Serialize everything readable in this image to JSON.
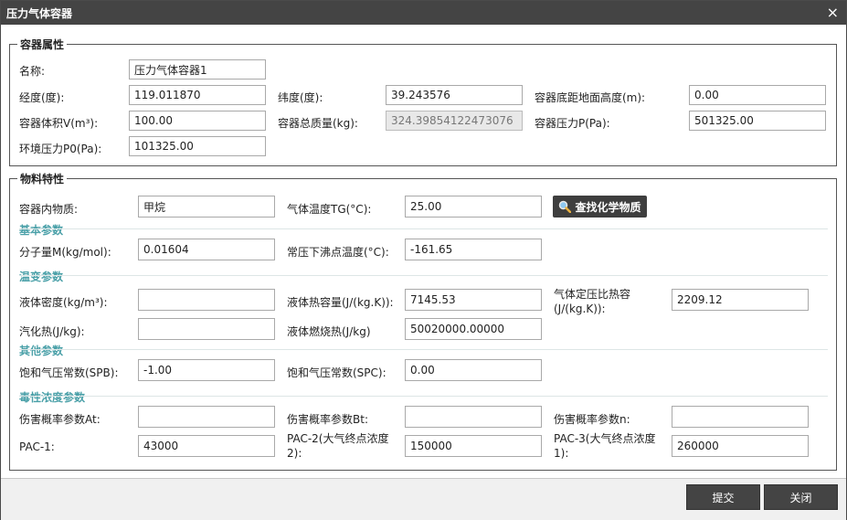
{
  "dialog": {
    "title": "压力气体容器",
    "close_icon": "×"
  },
  "container_props": {
    "legend": "容器属性",
    "name_label": "名称:",
    "name_value": "压力气体容器1",
    "lon_label": "经度(度):",
    "lon_value": "119.011870",
    "lat_label": "纬度(度):",
    "lat_value": "39.243576",
    "height_label": "容器底距地面高度(m):",
    "height_value": "0.00",
    "volume_label": "容器体积V(m³):",
    "volume_value": "100.00",
    "mass_label": "容器总质量(kg):",
    "mass_value": "324.39854122473076",
    "pressure_label": "容器压力P(Pa):",
    "pressure_value": "501325.00",
    "env_pressure_label": "环境压力P0(Pa):",
    "env_pressure_value": "101325.00"
  },
  "material_props": {
    "legend": "物料特性",
    "substance_label": "容器内物质:",
    "substance_value": "甲烷",
    "gas_temp_label": "气体温度TG(°C):",
    "gas_temp_value": "25.00",
    "search_button": "查找化学物质",
    "basic_heading": "基本参数",
    "mw_label": "分子量M(kg/mol):",
    "mw_value": "0.01604",
    "bp_label": "常压下沸点温度(°C):",
    "bp_value": "-161.65",
    "temp_heading": "温变参数",
    "liq_density_label": "液体密度(kg/m³):",
    "liq_density_value": "",
    "liq_heat_cap_label": "液体热容量(J/(kg.K)):",
    "liq_heat_cap_value": "7145.53",
    "gas_cp_label": "气体定压比热容(J/(kg.K)):",
    "gas_cp_value": "2209.12",
    "vap_heat_label": "汽化热(J/kg):",
    "vap_heat_value": "",
    "comb_heat_label": "液体燃烧热(J/kg)",
    "comb_heat_value": "50020000.00000",
    "other_heading": "其他参数",
    "spb_label": "饱和气压常数(SPB):",
    "spb_value": "-1.00",
    "spc_label": "饱和气压常数(SPC):",
    "spc_value": "0.00",
    "tox_heading": "毒性浓度参数",
    "at_label": "伤害概率参数At:",
    "at_value": "",
    "bt_label": "伤害概率参数Bt:",
    "bt_value": "",
    "n_label": "伤害概率参数n:",
    "n_value": "",
    "pac1_label": "PAC-1:",
    "pac1_value": "43000",
    "pac2_label": "PAC-2(大气终点浓度2):",
    "pac2_value": "150000",
    "pac3_label": "PAC-3(大气终点浓度1):",
    "pac3_value": "260000"
  },
  "footer": {
    "submit": "提交",
    "close": "关闭"
  }
}
